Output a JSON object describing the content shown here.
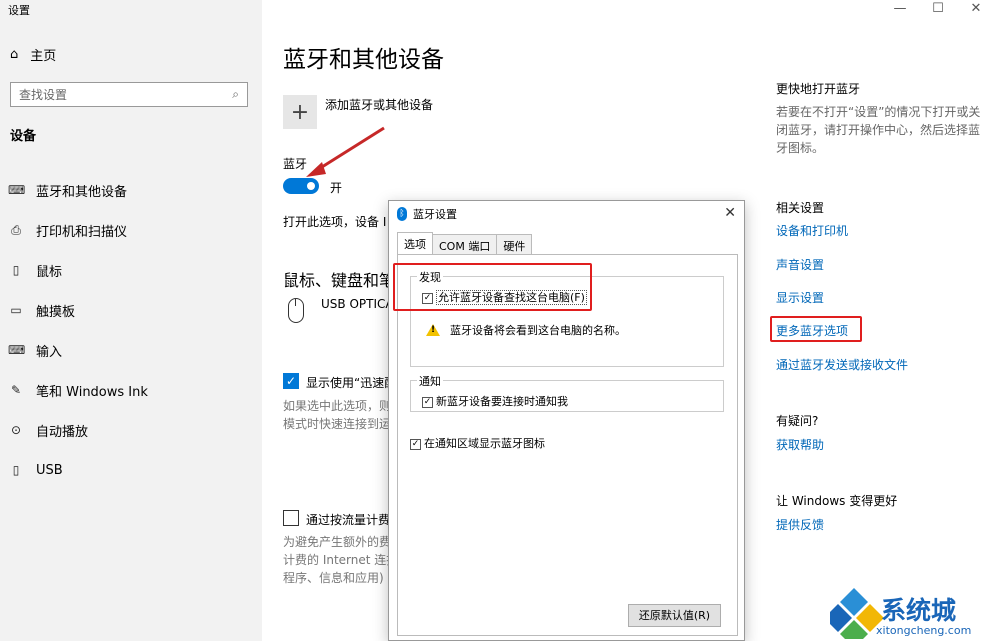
{
  "app": {
    "title": "设置"
  },
  "window_controls": {
    "minimize": "—",
    "maximize": "☐",
    "close": "✕"
  },
  "sidebar": {
    "home": "主页",
    "search_placeholder": "查找设置",
    "section": "设备",
    "items": [
      {
        "label": "蓝牙和其他设备",
        "icon": "bluetooth-devices-icon",
        "glyph": "⌨"
      },
      {
        "label": "打印机和扫描仪",
        "icon": "printer-icon",
        "glyph": "⎙"
      },
      {
        "label": "鼠标",
        "icon": "mouse-icon",
        "glyph": "▯"
      },
      {
        "label": "触摸板",
        "icon": "touchpad-icon",
        "glyph": "▭"
      },
      {
        "label": "输入",
        "icon": "keyboard-icon",
        "glyph": "⌨"
      },
      {
        "label": "笔和 Windows Ink",
        "icon": "pen-icon",
        "glyph": "✎"
      },
      {
        "label": "自动播放",
        "icon": "autoplay-icon",
        "glyph": "⊙"
      },
      {
        "label": "USB",
        "icon": "usb-icon",
        "glyph": "▯"
      }
    ]
  },
  "main": {
    "title": "蓝牙和其他设备",
    "add_device": "添加蓝牙或其他设备",
    "bluetooth_label": "蓝牙",
    "toggle_state": "开",
    "discover_text": "打开此选项，设备 I",
    "group_title": "鼠标、键盘和笔",
    "device_name": "USB OPTICAL",
    "download_cb_label": "显示使用“迅速配",
    "download_desc": [
      "如果选中此选项，则",
      "模式时快速连接到运"
    ],
    "metered_cb_label": "通过按流量计费",
    "metered_desc": [
      "为避免产生额外的费",
      "计费的 Internet 连接",
      "程序、信息和应用)"
    ]
  },
  "right_pane": {
    "quick_title": "更快地打开蓝牙",
    "quick_text": "若要在不打开“设置”的情况下打开或关闭蓝牙，请打开操作中心，然后选择蓝牙图标。",
    "related_title": "相关设置",
    "links": [
      "设备和打印机",
      "声音设置",
      "显示设置",
      "更多蓝牙选项",
      "通过蓝牙发送或接收文件"
    ],
    "question_title": "有疑问?",
    "help_link": "获取帮助",
    "improve_title": "让 Windows 变得更好",
    "feedback_link": "提供反馈"
  },
  "dialog": {
    "title": "蓝牙设置",
    "close": "✕",
    "tabs": [
      "选项",
      "COM 端口",
      "硬件"
    ],
    "discovery_legend": "发现",
    "allow_discover": "允许蓝牙设备查找这台电脑(F)",
    "warning": "蓝牙设备将会看到这台电脑的名称。",
    "notify_legend": "通知",
    "notify_new": "新蓝牙设备要连接时通知我",
    "show_tray": "在通知区域显示蓝牙图标",
    "restore_button": "还原默认值(R)"
  },
  "watermark": {
    "text": "系统城",
    "url": "xitongcheng.com"
  },
  "colors": {
    "accent": "#0078d7",
    "link": "#0067b8",
    "annotation": "#e01e1e",
    "watermark": "#1a66b8"
  }
}
